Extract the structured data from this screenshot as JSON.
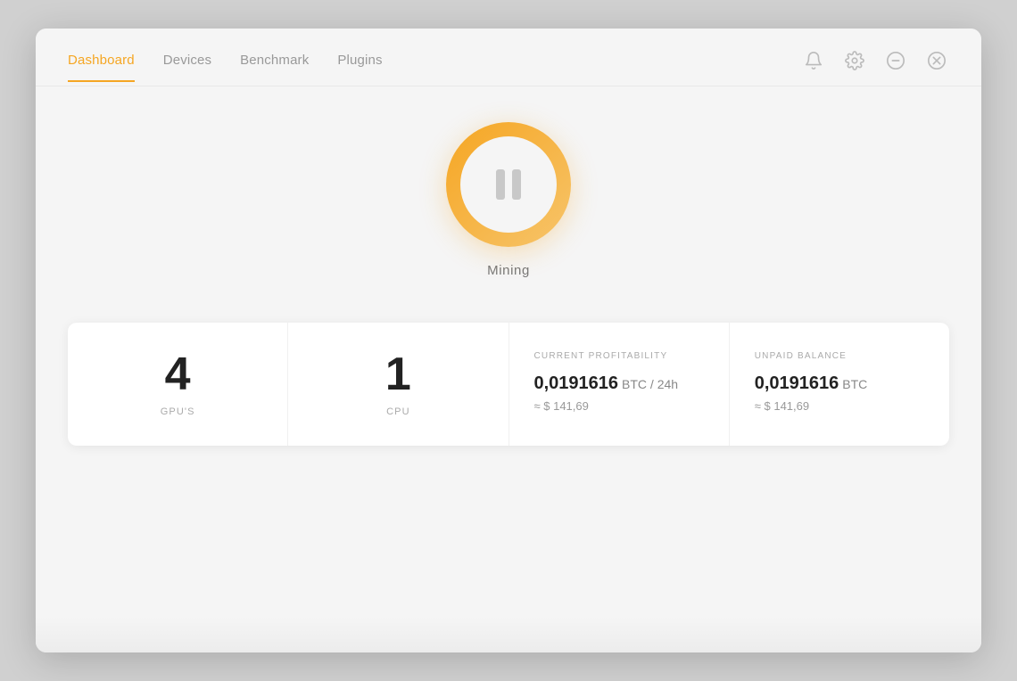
{
  "nav": {
    "items": [
      {
        "id": "dashboard",
        "label": "Dashboard",
        "active": true
      },
      {
        "id": "devices",
        "label": "Devices",
        "active": false
      },
      {
        "id": "benchmark",
        "label": "Benchmark",
        "active": false
      },
      {
        "id": "plugins",
        "label": "Plugins",
        "active": false
      }
    ]
  },
  "icons": {
    "bell": "bell-icon",
    "gear": "gear-icon",
    "minus": "minus-icon",
    "close": "close-icon"
  },
  "mining": {
    "status_label": "Mining",
    "button_state": "paused"
  },
  "stats": {
    "gpus": {
      "count": "4",
      "label": "GPU'S"
    },
    "cpu": {
      "count": "1",
      "label": "CPU"
    },
    "profitability": {
      "title": "CURRENT PROFITABILITY",
      "value": "0,0191616",
      "unit": "BTC / 24h",
      "approx": "≈ $ 141,69"
    },
    "balance": {
      "title": "UNPAID BALANCE",
      "value": "0,0191616",
      "unit": "BTC",
      "approx": "≈ $ 141,69"
    }
  },
  "colors": {
    "accent": "#f5a623",
    "active_nav": "#f5a623",
    "text_dark": "#222",
    "text_muted": "#aaa",
    "icon_color": "#bbb"
  }
}
